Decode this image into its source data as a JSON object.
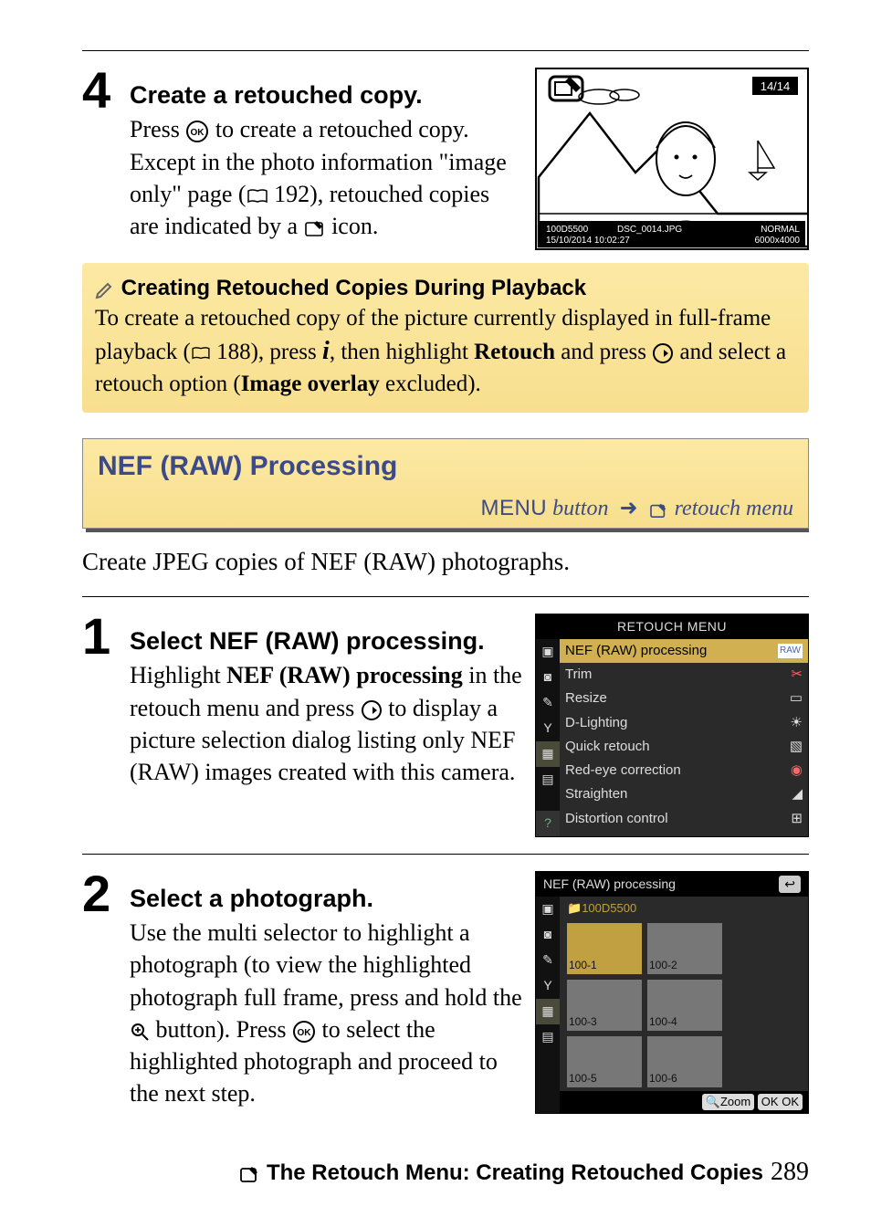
{
  "step4": {
    "num": "4",
    "head": "Create a retouched copy.",
    "line1a": "Press ",
    "line1b": " to create a retouched copy. Except in the photo information \"image only\" page (",
    "pageref": " 192), retouched copies are indicated by a ",
    "line_end": " icon.",
    "photo": {
      "counter": "14/14",
      "line1_left": "100D5500",
      "line1_mid": "DSC_0014.JPG",
      "line1_right": "NORMAL",
      "line2_left": "15/10/2014 10:02:27",
      "line2_right": "6000x4000"
    }
  },
  "note": {
    "title": "Creating Retouched Copies During Playback",
    "body_a": "To create a retouched copy of the picture currently displayed in full-frame playback (",
    "pageref": " 188), press ",
    "body_b": ", then highlight ",
    "retouch_label": "Retouch",
    "body_c": " and press ",
    "body_d": " and select a retouch option (",
    "overlay_label": "Image overlay",
    "body_e": " excluded)."
  },
  "nef": {
    "title": "NEF (RAW) Processing",
    "menu_label": "MENU",
    "button_word": " button",
    "arrow": "➜",
    "retouch_menu_label": " retouch menu"
  },
  "intro": "Create JPEG copies of NEF (RAW) photographs.",
  "step1": {
    "num": "1",
    "head": "Select NEF (RAW) processing.",
    "body_a": "Highlight ",
    "bold": "NEF (RAW) processing",
    "body_b": " in the retouch menu and press ",
    "body_c": " to display a picture selection dialog listing only NEF (RAW) images created with this camera."
  },
  "retouch_menu": {
    "title": "RETOUCH MENU",
    "items": [
      {
        "label": "NEF (RAW) processing",
        "icon": "RAW"
      },
      {
        "label": "Trim",
        "icon": "✂"
      },
      {
        "label": "Resize",
        "icon": "▭"
      },
      {
        "label": "D-Lighting",
        "icon": "☀"
      },
      {
        "label": "Quick retouch",
        "icon": "▧"
      },
      {
        "label": "Red-eye correction",
        "icon": "◉"
      },
      {
        "label": "Straighten",
        "icon": "◢"
      },
      {
        "label": "Distortion control",
        "icon": "⊞"
      }
    ]
  },
  "step2": {
    "num": "2",
    "head": "Select a photograph.",
    "body_a": "Use the multi selector to highlight a photograph (to view the highlighted photograph full frame, press and hold the ",
    "body_b": " button).  Press ",
    "body_c": " to select the highlighted photograph and proceed to the next step."
  },
  "nef_proc": {
    "title": "NEF (RAW) processing",
    "folder": "100D5500",
    "thumbs": [
      "100-1",
      "100-2",
      "100-3",
      "100-4",
      "100-5",
      "100-6"
    ],
    "footer_zoom": "Zoom",
    "footer_ok": "OK"
  },
  "footer": {
    "title": "The Retouch Menu: Creating Retouched Copies",
    "page": "289"
  }
}
